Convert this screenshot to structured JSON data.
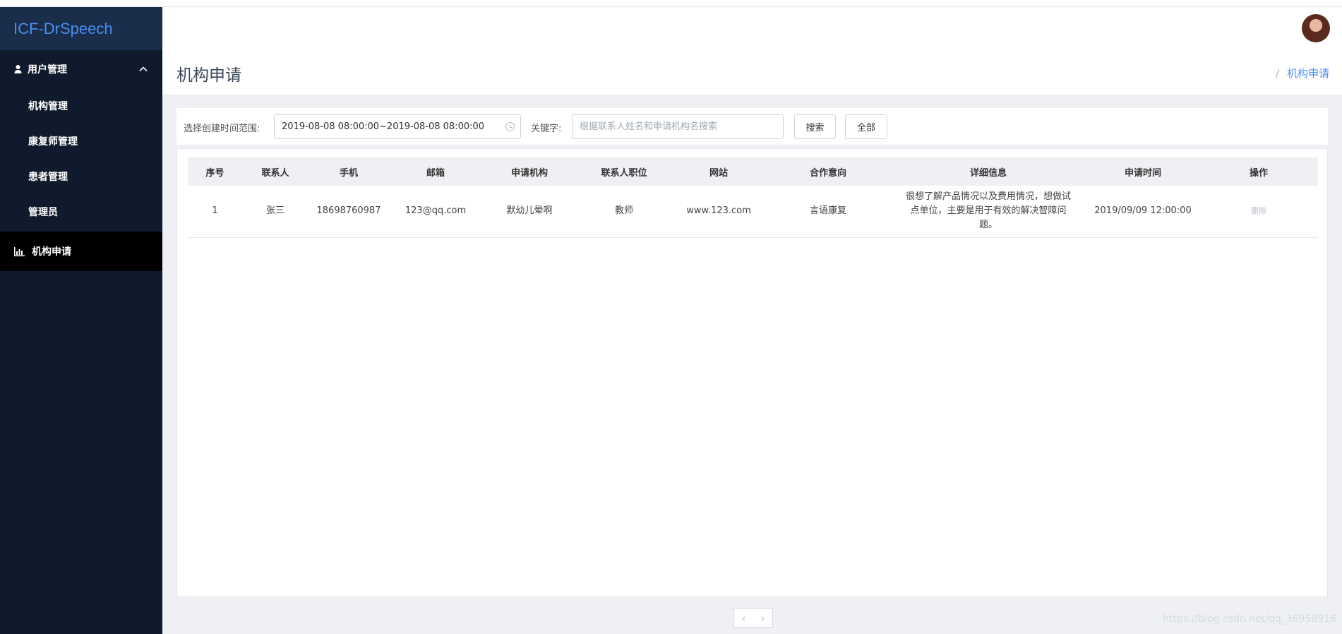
{
  "app": {
    "logo": "ICF-DrSpeech"
  },
  "sidebar": {
    "group": {
      "label": "用户管理",
      "icon": "user-icon"
    },
    "sub_items": [
      {
        "label": "机构管理"
      },
      {
        "label": "康复师管理"
      },
      {
        "label": "患者管理"
      },
      {
        "label": "管理员"
      }
    ],
    "active": {
      "label": "机构申请",
      "icon": "bar-chart-icon"
    }
  },
  "header": {
    "title": "机构申请",
    "breadcrumb_sep": "/",
    "breadcrumb": "机构申请"
  },
  "filter": {
    "date_label": "选择创建时间范围:",
    "date_value": "2019-08-08 08:00:00~2019-08-08 08:00:00",
    "keyword_label": "关键字:",
    "keyword_placeholder": "根据联系人姓名和申请机构名搜索",
    "keyword_value": "",
    "search_button": "搜索",
    "all_button": "全部"
  },
  "table": {
    "headers": [
      "序号",
      "联系人",
      "手机",
      "邮箱",
      "申请机构",
      "联系人职位",
      "网站",
      "合作意向",
      "详细信息",
      "申请时间",
      "操作"
    ],
    "rows": [
      {
        "index": "1",
        "contact": "张三",
        "phone": "18698760987",
        "email": "123@qq.com",
        "org": "默幼儿晕啊",
        "position": "教师",
        "website": "www.123.com",
        "intent": "言语康复",
        "detail": "很想了解产品情况以及费用情况，想做试点单位，主要是用于有效的解决智障问题。",
        "time": "2019/09/09 12:00:00",
        "action": "删除"
      }
    ]
  },
  "pager": {
    "prev": "‹",
    "next": "›"
  },
  "watermark": "https://blog.csdn.net/qq_36958916"
}
